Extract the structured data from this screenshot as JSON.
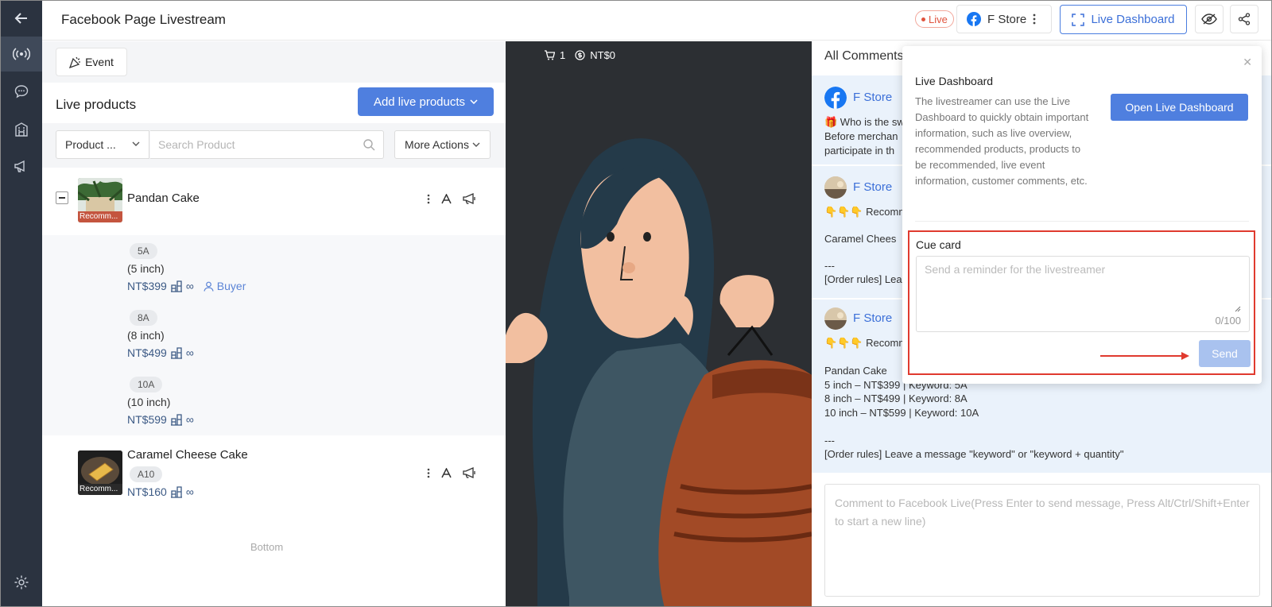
{
  "app": {
    "title": "Facebook Page Livestream",
    "brand_color": "#4f7fdf"
  },
  "header": {
    "live_badge": "Live",
    "store_name": "F Store",
    "dashboard_button": "Live Dashboard"
  },
  "rail": {
    "icons": [
      "back-arrow-icon",
      "broadcast-icon",
      "chat-icon",
      "store-icon",
      "megaphone-icon",
      "settings-icon"
    ]
  },
  "left": {
    "event_button": "Event",
    "section_title": "Live products",
    "add_button": "Add live products",
    "filter_select": "Product ...",
    "search_placeholder": "Search Product",
    "more_actions": "More Actions",
    "products": [
      {
        "name": "Pandan Cake",
        "tag": "Recomm...",
        "variants": [
          {
            "keyword": "5A",
            "size": "(5 inch)",
            "price": "NT$399",
            "stock": "∞",
            "buyer": "Buyer"
          },
          {
            "keyword": "8A",
            "size": "(8 inch)",
            "price": "NT$499",
            "stock": "∞"
          },
          {
            "keyword": "10A",
            "size": "(10 inch)",
            "price": "NT$599",
            "stock": "∞"
          }
        ]
      },
      {
        "name": "Caramel Cheese Cake",
        "tag": "Recomm...",
        "keyword": "A10",
        "price": "NT$160",
        "stock": "∞"
      }
    ],
    "bottom_text": "Bottom"
  },
  "video": {
    "cart_count": "1",
    "amount": "NT$0"
  },
  "comments": {
    "header": "All Comments",
    "items": [
      {
        "author": "F Store",
        "lines": [
          "🎁 Who is the sw",
          "Before merchan",
          "participate in th"
        ]
      },
      {
        "author": "F Store",
        "lines": [
          "👇👇👇 Recomm",
          "",
          "Caramel Chees",
          "",
          "---",
          "[Order rules] Lea"
        ]
      },
      {
        "author": "F Store",
        "lines": [
          "👇👇👇 Recomm",
          "",
          "Pandan Cake",
          "5 inch – NT$399 | Keyword: 5A",
          "8 inch – NT$499 | Keyword: 8A",
          "10 inch – NT$599 | Keyword: 10A",
          "",
          "---",
          "[Order rules] Leave a message \"keyword\" or \"keyword + quantity\""
        ]
      }
    ],
    "compose_placeholder": "Comment to Facebook Live(Press Enter to send message, Press Alt/Ctrl/Shift+Enter to start a new line)"
  },
  "popup": {
    "title": "Live Dashboard",
    "description": "The livestreamer can use the Live Dashboard to quickly obtain important information, such as live overview, recommended products, products to be recommended, live event information, customer comments, etc.",
    "open_button": "Open Live Dashboard",
    "cue_title": "Cue card",
    "cue_placeholder": "Send a reminder for the livestreamer",
    "cue_count": "0/100",
    "send_button": "Send",
    "highlight_color": "#e03a2f"
  }
}
